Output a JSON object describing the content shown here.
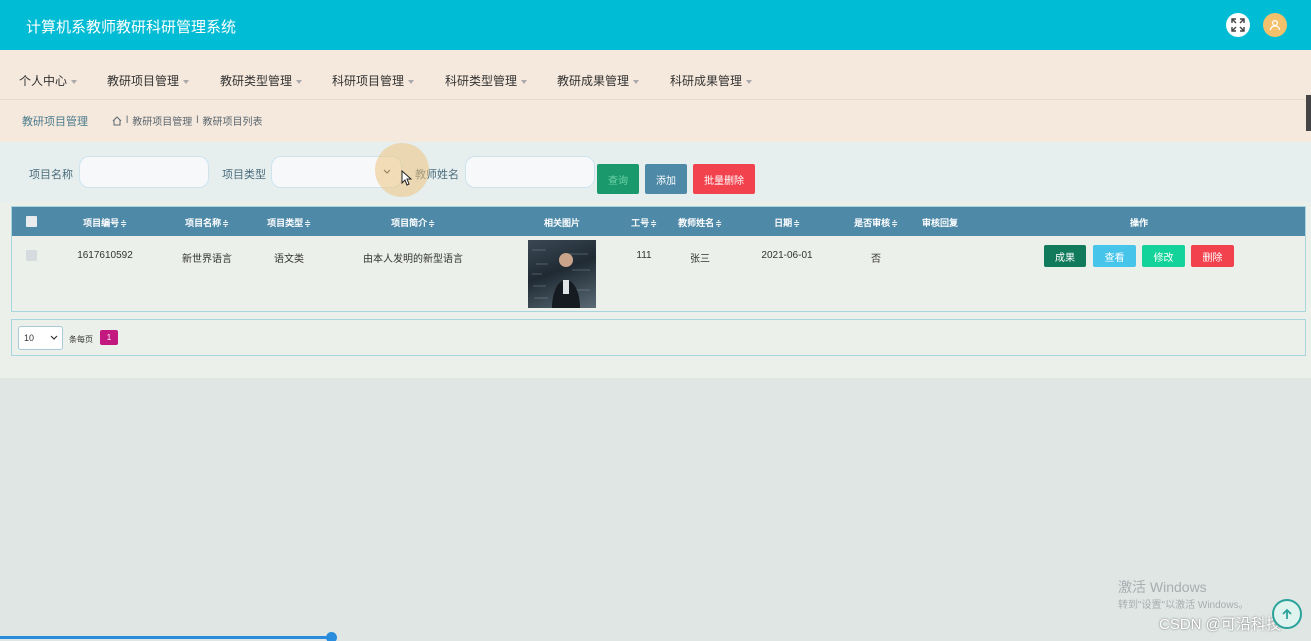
{
  "app": {
    "title": "计算机系教师教研科研管理系统"
  },
  "nav": [
    {
      "label": "个人中心"
    },
    {
      "label": "教研项目管理"
    },
    {
      "label": "教研类型管理"
    },
    {
      "label": "科研项目管理"
    },
    {
      "label": "科研类型管理"
    },
    {
      "label": "教研成果管理"
    },
    {
      "label": "科研成果管理"
    }
  ],
  "breadcrumb": {
    "section": "教研项目管理",
    "trail": [
      "教研项目管理",
      "教研项目列表"
    ],
    "separator": "l"
  },
  "search": {
    "name_label": "项目名称",
    "name_value": "",
    "type_label": "项目类型",
    "type_value": "",
    "teacher_label": "教师姓名",
    "teacher_value": "",
    "query_label": "查询",
    "add_label": "添加",
    "batch_delete_label": "批量删除"
  },
  "table": {
    "sort_glyph": "≑",
    "columns": [
      "项目编号",
      "项目名称",
      "项目类型",
      "项目简介",
      "相关图片",
      "工号",
      "教师姓名",
      "日期",
      "是否审核",
      "审核回复",
      "操作"
    ],
    "rows": [
      {
        "id": "1617610592",
        "name": "新世界语言",
        "type": "语文类",
        "intro": "由本人发明的新型语言",
        "job_no": "111",
        "teacher": "张三",
        "date": "2021-06-01",
        "reviewed": "否",
        "reply": ""
      }
    ],
    "actions": [
      "成果",
      "查看",
      "修改",
      "删除"
    ]
  },
  "pager": {
    "page_size": "10",
    "per_page_label": "条每页",
    "current_page": "1"
  },
  "overlay": {
    "activate_title": "激活 Windows",
    "activate_hint": "转到\"设置\"以激活 Windows。",
    "csdn": "CSDN @可沿科技"
  },
  "colors": {
    "header": "#00bcd4",
    "nav_bg": "#f5e8dc",
    "table_head": "#4e8aa8",
    "query_btn": "#1a9a6c",
    "add_btn": "#4e8aa8",
    "batch_delete_btn": "#f2424e",
    "result_btn": "#117a5a",
    "view_btn": "#47c4ea",
    "edit_btn": "#14d39a",
    "delete_btn": "#f2424e",
    "page_active": "#c2187f"
  },
  "icons": [
    "fullscreen-icon",
    "user-avatar-icon",
    "home-icon",
    "chevron-down-icon",
    "cursor-icon",
    "scroll-top-icon"
  ]
}
